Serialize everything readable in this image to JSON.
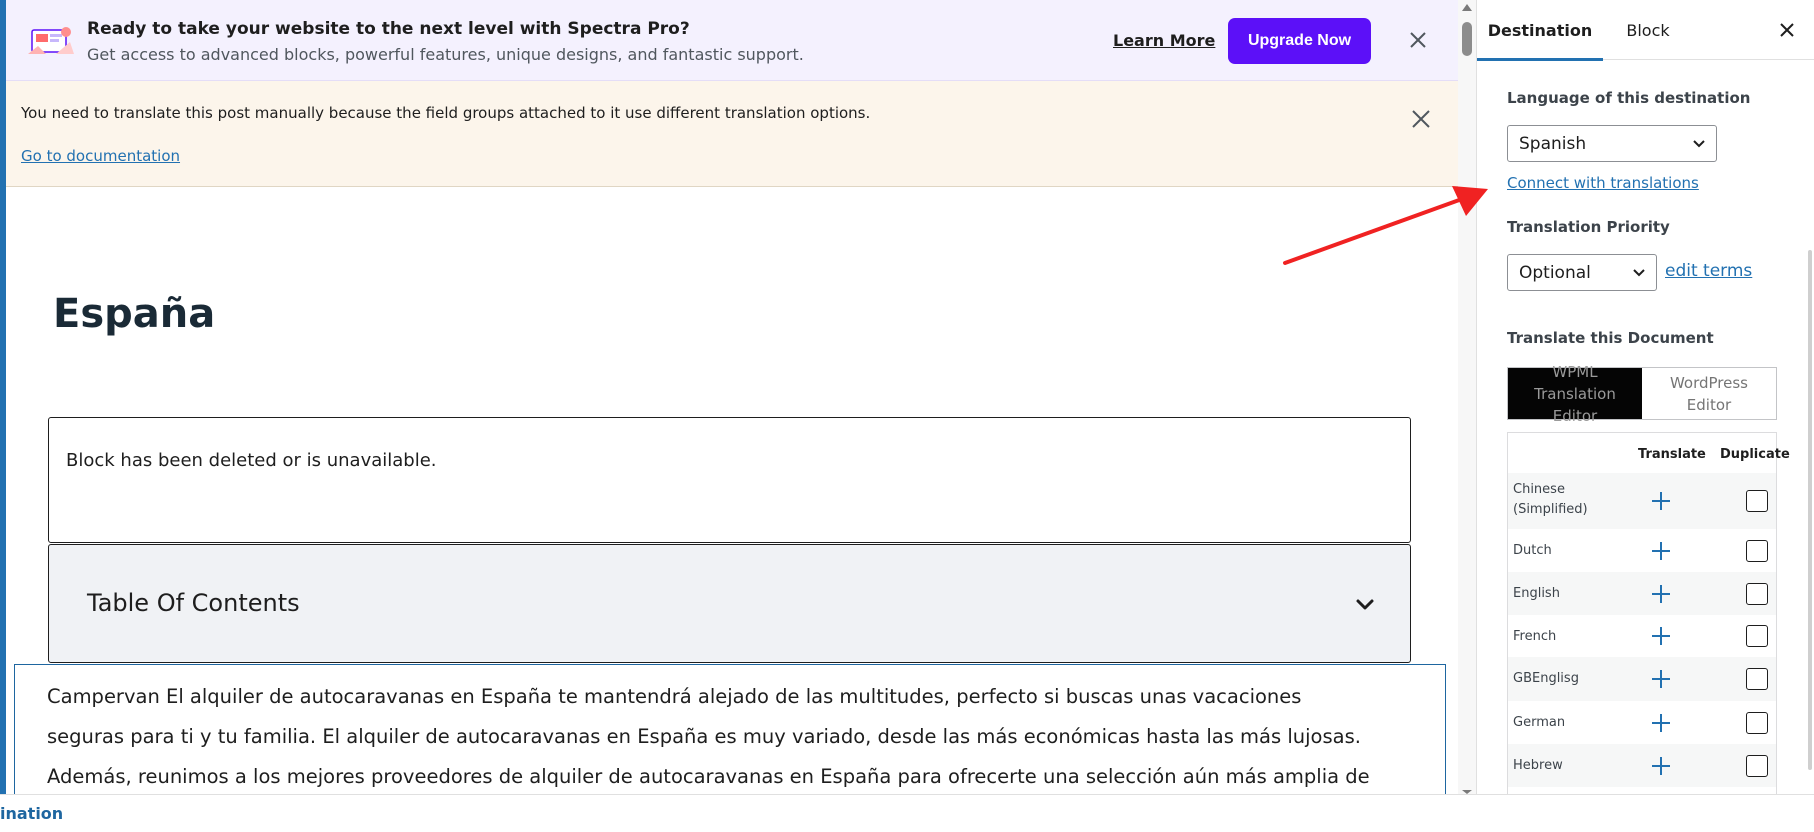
{
  "promo": {
    "title": "Ready to take your website to the next level with Spectra Pro?",
    "subtitle": "Get access to advanced blocks, powerful features, unique designs, and fantastic support.",
    "learn_more": "Learn More",
    "upgrade": "Upgrade Now",
    "accent": "#5c10f8"
  },
  "notice": {
    "text": "You need to translate this post manually because the field groups attached to it use different translation options.",
    "link": "Go to documentation"
  },
  "post": {
    "title": "España",
    "missing_block": "Block has been deleted or is unavailable.",
    "toc_title": "Table Of Contents",
    "paragraph_lines": [
      "Campervan El alquiler de autocaravanas en España te mantendrá alejado de las multitudes, perfecto si buscas unas vacaciones",
      "seguras para ti y tu familia. El alquiler de autocaravanas en España es muy variado, desde las más económicas hasta las más lujosas.",
      "Además, reunimos a los mejores proveedores de alquiler de autocaravanas en España para ofrecerte una selección aún más amplia de"
    ]
  },
  "sidebar": {
    "tabs": [
      {
        "label": "Destination",
        "active": true
      },
      {
        "label": "Block",
        "active": false
      }
    ],
    "language_label": "Language of this destination",
    "language_value": "Spanish",
    "connect_link": "Connect with translations",
    "priority_label": "Translation Priority",
    "priority_value": "Optional",
    "edit_terms": "edit terms",
    "translate_doc_label": "Translate this Document",
    "editor_options": [
      {
        "label": "WPML Translation Editor",
        "active": true
      },
      {
        "label": "WordPress Editor",
        "active": false
      }
    ],
    "table_headers": {
      "translate": "Translate",
      "duplicate": "Duplicate"
    },
    "languages": [
      "Chinese (Simplified)",
      "Dutch",
      "English",
      "French",
      "GBEnglisg",
      "German",
      "Hebrew"
    ],
    "link_color": "#2271b1"
  },
  "bottom": {
    "breadcrumb": "ination"
  }
}
